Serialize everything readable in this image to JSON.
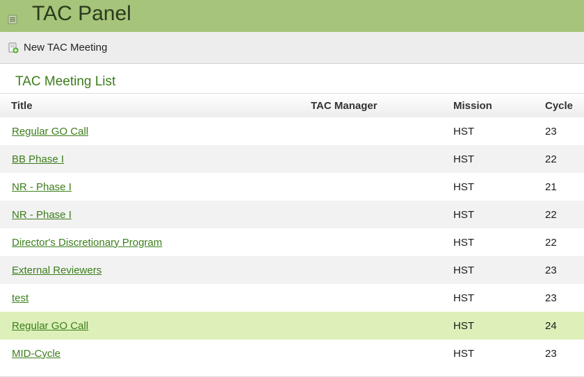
{
  "header": {
    "title": "TAC Panel"
  },
  "toolbar": {
    "new_label": "New TAC Meeting"
  },
  "section": {
    "title": "TAC Meeting List"
  },
  "table": {
    "columns": {
      "title": "Title",
      "manager": "TAC Manager",
      "mission": "Mission",
      "cycle": "Cycle"
    },
    "rows": [
      {
        "title": "Regular GO Call",
        "manager": "",
        "mission": "HST",
        "cycle": "23"
      },
      {
        "title": "BB Phase I",
        "manager": "",
        "mission": "HST",
        "cycle": "22"
      },
      {
        "title": "NR - Phase I",
        "manager": "",
        "mission": "HST",
        "cycle": "21"
      },
      {
        "title": "NR - Phase I",
        "manager": "",
        "mission": "HST",
        "cycle": "22"
      },
      {
        "title": "Director's Discretionary Program",
        "manager": "",
        "mission": "HST",
        "cycle": "22"
      },
      {
        "title": "External Reviewers",
        "manager": "",
        "mission": "HST",
        "cycle": "23"
      },
      {
        "title": "test",
        "manager": "",
        "mission": "HST",
        "cycle": "23"
      },
      {
        "title": "Regular GO Call",
        "manager": "",
        "mission": "HST",
        "cycle": "24"
      },
      {
        "title": "MID-Cycle",
        "manager": "",
        "mission": "HST",
        "cycle": "23"
      }
    ]
  },
  "colors": {
    "header_bg": "#a6c47a",
    "link": "#3b7d1a",
    "row_highlight": "#ddf0b9",
    "row_alt": "#f2f2f2"
  },
  "icons": {
    "menu": "menu-icon",
    "new": "new-meeting-icon"
  }
}
